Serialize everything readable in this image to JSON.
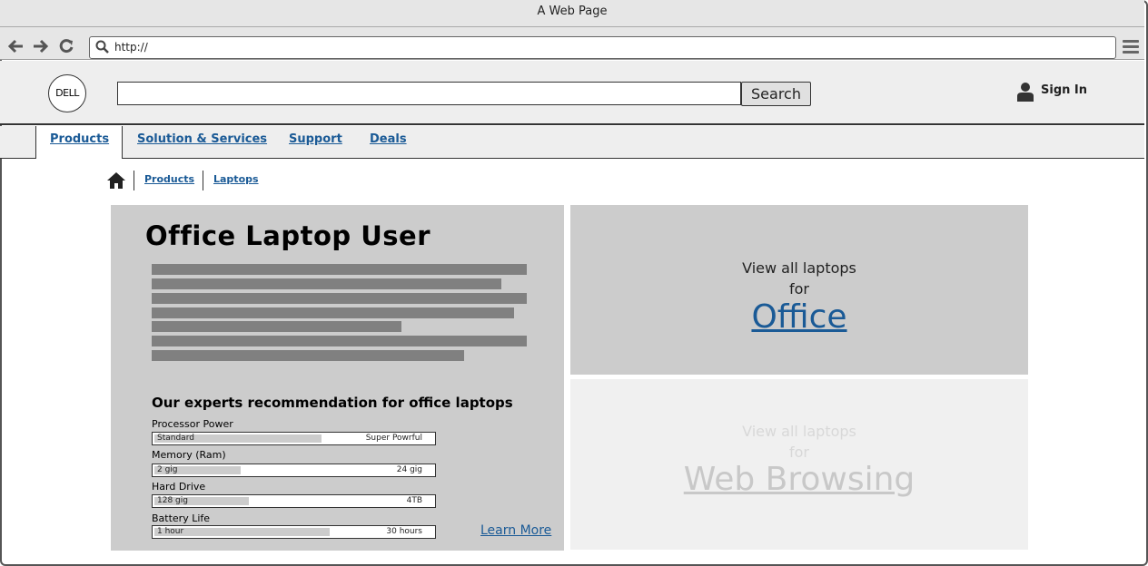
{
  "window": {
    "title": "A Web Page"
  },
  "browser": {
    "url": "http://"
  },
  "header": {
    "logo_text": "DELL",
    "search_button": "Search",
    "signin_label": "Sign In"
  },
  "nav": {
    "items": [
      {
        "label": "Products",
        "active": true
      },
      {
        "label": "Solution & Services"
      },
      {
        "label": "Support"
      },
      {
        "label": "Deals"
      }
    ]
  },
  "breadcrumb": {
    "items": [
      {
        "label": "Products"
      },
      {
        "label": "Laptops"
      }
    ]
  },
  "main": {
    "title": "Office Laptop User",
    "recommendation_title": "Our experts recommendation for office laptops",
    "specs": [
      {
        "label": "Processor Power",
        "min": "Standard",
        "max": "Super Powrful",
        "level": 0.6
      },
      {
        "label": "Memory (Ram)",
        "min": "2 gig",
        "max": "24 gig",
        "level": 0.31
      },
      {
        "label": "Hard Drive",
        "min": "128 gig",
        "max": "4TB",
        "level": 0.34
      },
      {
        "label": "Battery Life",
        "min": "1 hour",
        "max": "30 hours",
        "level": 0.63
      }
    ],
    "learn_more": "Learn More"
  },
  "tiles": {
    "office": {
      "line1": "View all laptops",
      "line2": "for",
      "link": "Office"
    },
    "web": {
      "line1": "View all laptops",
      "line2": "for",
      "link": "Web Browsing"
    }
  },
  "colors": {
    "link": "#1a5a96",
    "panel": "#cccccc",
    "panel_light": "#f0f0f0"
  }
}
